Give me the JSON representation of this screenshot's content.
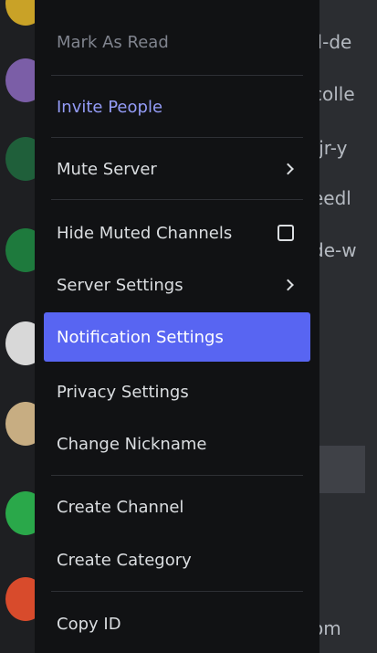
{
  "menu": {
    "items": [
      {
        "label": "Mark As Read",
        "state": "disabled"
      },
      {
        "label": "Invite People",
        "state": "accent"
      },
      {
        "label": "Mute Server",
        "state": "normal",
        "icon": "chevron-right-icon"
      },
      {
        "label": "Hide Muted Channels",
        "state": "normal",
        "icon": "checkbox-icon",
        "checked": false
      },
      {
        "label": "Server Settings",
        "state": "normal",
        "icon": "chevron-right-icon"
      },
      {
        "label": "Notification Settings",
        "state": "highlighted"
      },
      {
        "label": "Privacy Settings",
        "state": "normal"
      },
      {
        "label": "Change Nickname",
        "state": "normal"
      },
      {
        "label": "Create Channel",
        "state": "normal"
      },
      {
        "label": "Create Category",
        "state": "normal"
      },
      {
        "label": "Copy ID",
        "state": "normal"
      }
    ]
  },
  "background_channels": [
    "ll-de",
    "colle",
    "-jr-y",
    "eedl",
    "de-w",
    "om"
  ],
  "colors": {
    "menu_bg": "#111214",
    "highlight": "#5865f2",
    "accent_text": "#949cf7",
    "disabled_text": "#80848e",
    "text": "#dbdee1"
  }
}
